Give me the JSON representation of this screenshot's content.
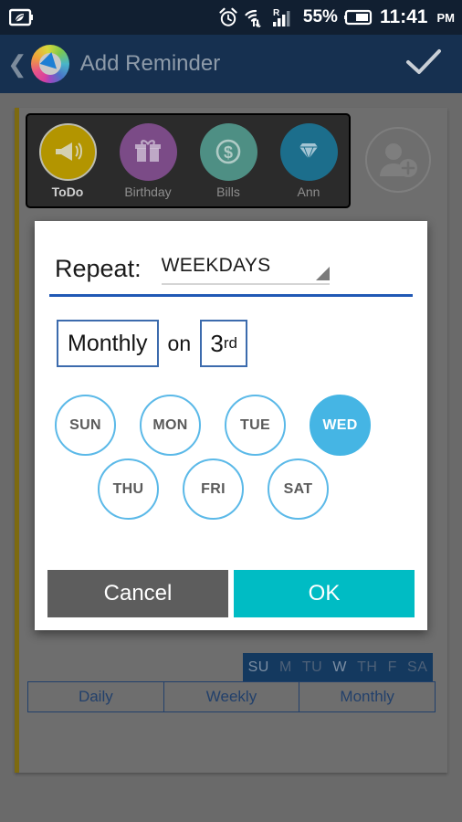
{
  "status_bar": {
    "left_icons": [
      "leaf-battery-saver-icon"
    ],
    "alarm_icon": "alarm-clock-icon",
    "wifi_icon": "wifi-transfer-icon",
    "roaming_icon": "roaming-signal-icon",
    "battery_percent": "55%",
    "battery_icon": "battery-icon",
    "time": "11:41",
    "ampm": "PM"
  },
  "app_bar": {
    "back_glyph": "❮",
    "logo_icon": "app-logo-icon",
    "title": "Add Reminder",
    "confirm_icon": "checkmark-icon",
    "bg_color": "#163050",
    "title_color": "#8e9ba9"
  },
  "categories": [
    {
      "label": "ToDo",
      "icon": "megaphone-icon",
      "glyph": "📢",
      "color": "#b39500",
      "selected": true
    },
    {
      "label": "Birthday",
      "icon": "gift-icon",
      "glyph": "🎁",
      "color": "#7b4b87",
      "selected": false
    },
    {
      "label": "Bills",
      "icon": "dollar-icon",
      "glyph": "💲",
      "color": "#4e8f84",
      "selected": false
    },
    {
      "label": "Ann",
      "icon": "diamond-icon",
      "glyph": "💎",
      "color": "#1c6e8c",
      "selected": false
    }
  ],
  "add_category": {
    "icon": "add-person-icon",
    "label": ""
  },
  "background_form": {
    "weekday_chip": {
      "days": [
        "SU",
        "M",
        "TU",
        "W",
        "TH",
        "F",
        "SA"
      ],
      "active": [
        "SU",
        "W"
      ],
      "bg_color": "#14395f"
    },
    "tabs": [
      {
        "label": "Daily",
        "selected": false
      },
      {
        "label": "Weekly",
        "selected": false
      },
      {
        "label": "Monthly",
        "selected": true
      }
    ]
  },
  "dialog": {
    "repeat_label": "Repeat:",
    "repeat_value": "WEEKDAYS",
    "repeat_options": [
      "WEEKDAYS"
    ],
    "dropdown_icon": "dropdown-triangle-icon",
    "divider_color": "#2159b5",
    "frequency_value": "Monthly",
    "on_label": "on",
    "day_number": "3",
    "day_ordinal_suffix": "rd",
    "days": [
      {
        "label": "SUN",
        "selected": false
      },
      {
        "label": "MON",
        "selected": false
      },
      {
        "label": "TUE",
        "selected": false
      },
      {
        "label": "WED",
        "selected": true
      },
      {
        "label": "THU",
        "selected": false
      },
      {
        "label": "FRI",
        "selected": false
      },
      {
        "label": "SAT",
        "selected": false
      }
    ],
    "selected_day_color": "#45b5e4",
    "day_outline_color": "#5bb9e8",
    "cancel_label": "Cancel",
    "ok_label": "OK",
    "cancel_color": "#5d5d5d",
    "ok_color": "#00bcc4"
  }
}
